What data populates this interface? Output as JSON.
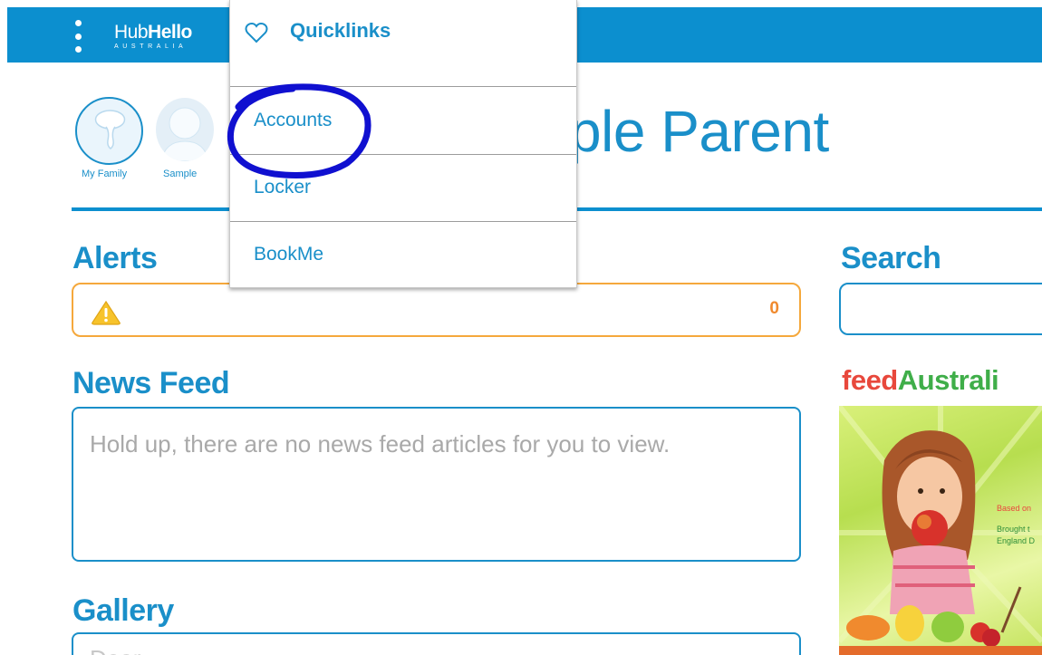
{
  "topbar": {
    "logo_light": "Hub",
    "logo_bold": "Hello",
    "logo_sub": "AUSTRALIA",
    "menu_icon": "kebab-menu-icon",
    "color": "#0c8fcf"
  },
  "profiles": [
    {
      "label": "My Family",
      "icon": "family-avatar-icon"
    },
    {
      "label": "Sample",
      "icon": "person-avatar-icon"
    }
  ],
  "welcome": {
    "partial_title": "ple Parent"
  },
  "alerts": {
    "heading": "Alerts",
    "count": "0",
    "icon": "warning-icon",
    "border_color": "#f5a83c"
  },
  "news_feed": {
    "heading": "News Feed",
    "empty_text": "Hold up, there are no news feed articles for you to view."
  },
  "gallery": {
    "heading": "Gallery",
    "partial_text": "Dear ... ... ..."
  },
  "search": {
    "heading": "Search",
    "value": ""
  },
  "feed_australia": {
    "title_part1": "feed",
    "title_part2": "Australi",
    "caption1": "Based on",
    "caption2a": "Brought t",
    "caption2b": "England D"
  },
  "quicklinks": {
    "header_label": "Quicklinks",
    "header_icon": "heart-icon",
    "items": [
      {
        "label": "Accounts"
      },
      {
        "label": "Locker"
      },
      {
        "label": "BookMe"
      }
    ]
  },
  "annotation": {
    "color": "#1010d0",
    "target": "Accounts"
  },
  "colors": {
    "accent": "#1a8fc9",
    "alert_orange": "#f08a2e",
    "feed_red": "#e8483c",
    "feed_green": "#3fae49"
  }
}
